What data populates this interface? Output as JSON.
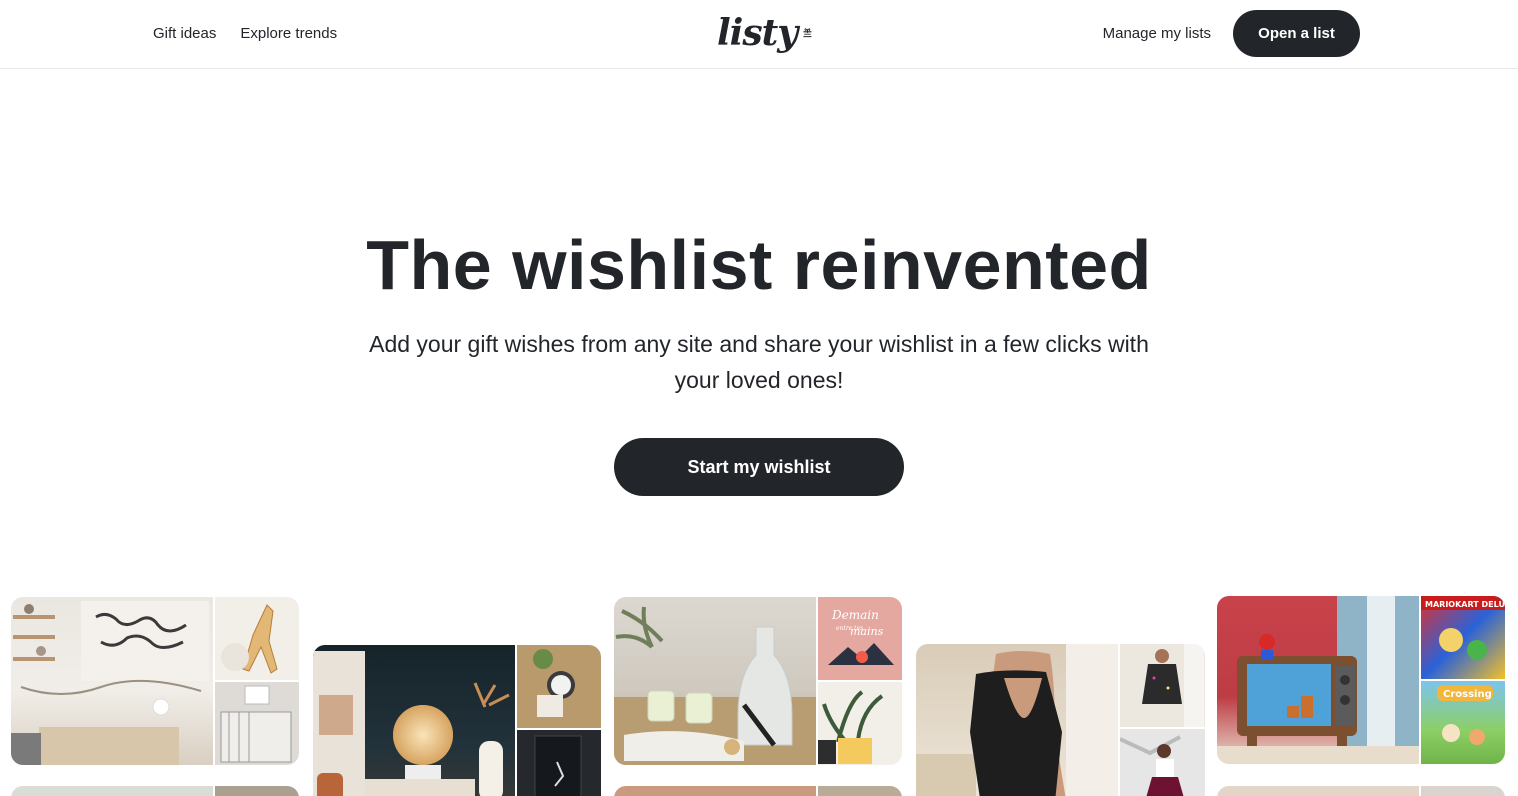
{
  "header": {
    "nav_left": [
      "Gift ideas",
      "Explore trends"
    ],
    "logo_text": "listy",
    "manage_label": "Manage my lists",
    "open_label": "Open a list"
  },
  "hero": {
    "title": "The wishlist reinvented",
    "subtitle": "Add your gift wishes from any site and share your wishlist in a few clicks with your loved ones!",
    "cta_label": "Start my wishlist"
  },
  "gallery": {
    "card3_side_text": "Demain entre tes mains",
    "card5_side_top_text": "MARIOKART DELUXE",
    "card5_side_bottom_text": "Crossing"
  },
  "colors": {
    "text": "#22252a",
    "button": "#22252a",
    "border": "#e8e8e8"
  }
}
